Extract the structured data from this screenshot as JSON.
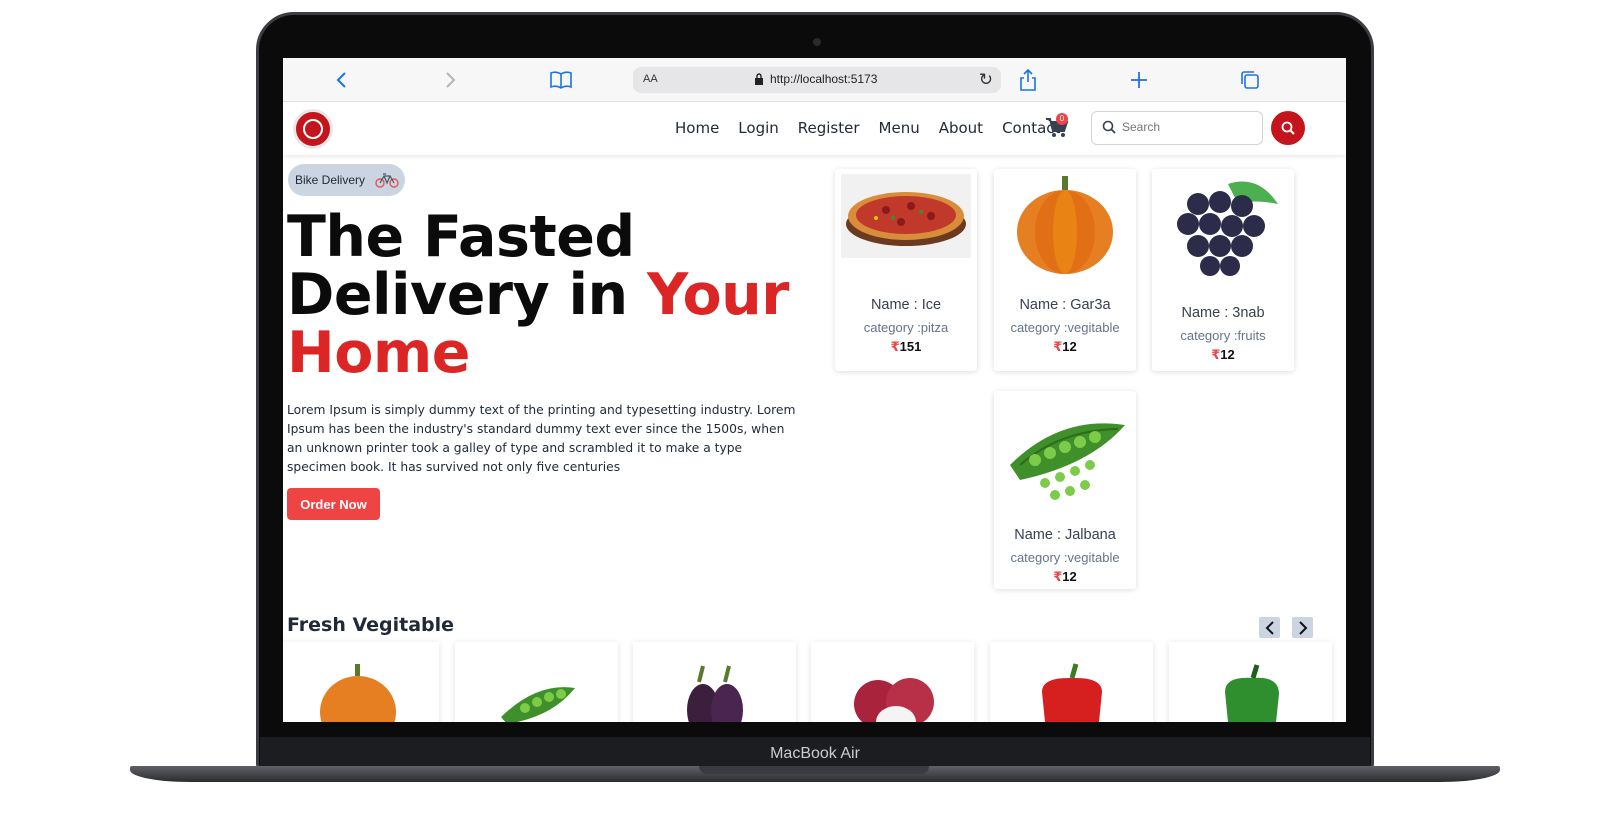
{
  "device": {
    "label": "MacBook Air"
  },
  "browser": {
    "url_aa": "AA",
    "url": "http://localhost:5173"
  },
  "nav": {
    "links": [
      "Home",
      "Login",
      "Register",
      "Menu",
      "About",
      "Contact"
    ],
    "cart_count": "0",
    "search_placeholder": "Search"
  },
  "hero": {
    "badge": "Bike Delivery",
    "title_line1": "The Fasted",
    "title_line2_black": "Delivery in ",
    "title_line2_red": "Your",
    "title_line3_red": "Home",
    "description": "Lorem Ipsum is simply dummy text of the printing and typesetting industry. Lorem Ipsum has been the industry's standard dummy text ever since the 1500s, when an unknown printer took a galley of type and scrambled it to make a type specimen book. It has survived not only five centuries",
    "order_button": "Order Now"
  },
  "products": [
    {
      "name": "Name : Ice",
      "category": "category :pitza",
      "currency": "₹",
      "price": "151",
      "icon": "pizza-image"
    },
    {
      "name": "Name : Gar3a",
      "category": "category :vegitable",
      "currency": "₹",
      "price": "12",
      "icon": "pumpkin-image"
    },
    {
      "name": "Name : 3nab",
      "category": "category :fruits",
      "currency": "₹",
      "price": "12",
      "icon": "grapes-image"
    },
    {
      "name": "Name : Jalbana",
      "category": "category :vegitable",
      "currency": "₹",
      "price": "12",
      "icon": "peas-image"
    }
  ],
  "fresh": {
    "title": "Fresh Vegitable",
    "items": [
      "pumpkin-image",
      "peas-image",
      "eggplant-image",
      "onion-image",
      "red-pepper-image",
      "green-pepper-image"
    ]
  },
  "colors": {
    "brand_red": "#dc2626",
    "button_red": "#ef4444",
    "pill_bg": "#cbd5e1"
  }
}
